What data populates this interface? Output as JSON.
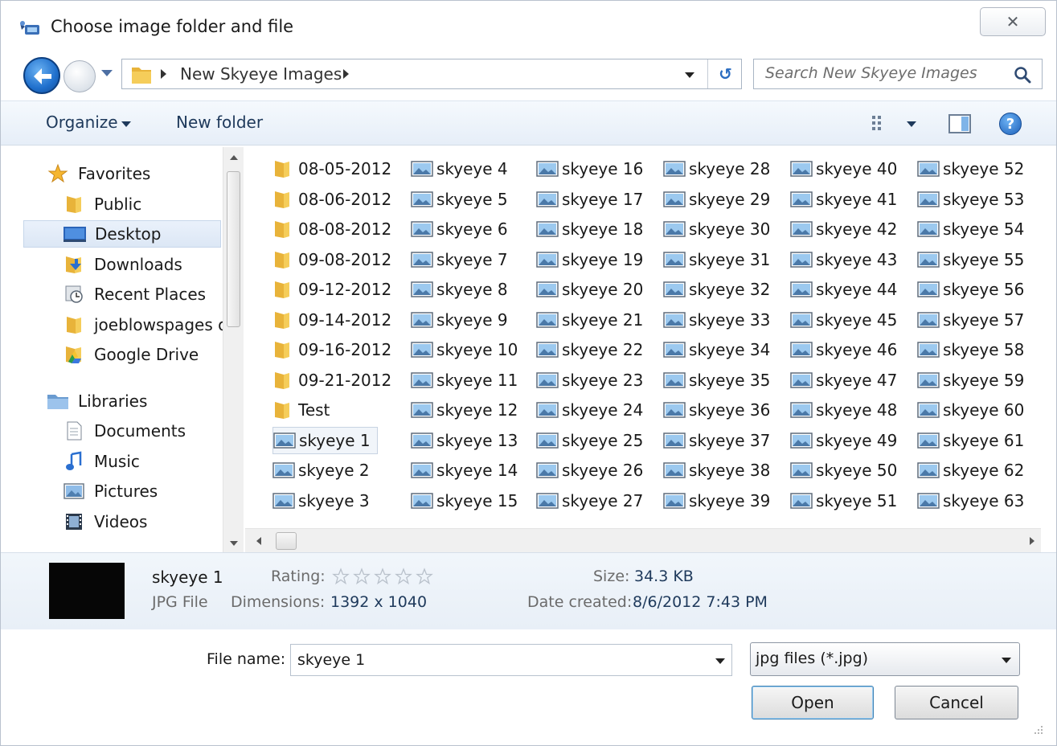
{
  "window": {
    "title": "Choose image folder and file",
    "close_glyph": "✕"
  },
  "address": {
    "path": "New Skyeye Images",
    "search_placeholder": "Search New Skyeye Images"
  },
  "toolbar": {
    "organize": "Organize",
    "new_folder": "New folder",
    "help_glyph": "?"
  },
  "nav": {
    "items": [
      {
        "label": "Favorites",
        "icon": "star-icon",
        "indent": 0
      },
      {
        "label": "Public",
        "icon": "folder-icon",
        "indent": 1
      },
      {
        "label": "Desktop",
        "icon": "desktop-icon",
        "indent": 1,
        "selected": true
      },
      {
        "label": "Downloads",
        "icon": "downloads-icon",
        "indent": 1
      },
      {
        "label": "Recent Places",
        "icon": "recent-places-icon",
        "indent": 1
      },
      {
        "label": "joeblowspages o",
        "icon": "folder-icon",
        "indent": 1
      },
      {
        "label": "Google Drive",
        "icon": "google-drive-icon",
        "indent": 1
      },
      {
        "label": "Libraries",
        "icon": "libraries-icon",
        "indent": 0,
        "gap": true
      },
      {
        "label": "Documents",
        "icon": "document-icon",
        "indent": 1
      },
      {
        "label": "Music",
        "icon": "music-icon",
        "indent": 1
      },
      {
        "label": "Pictures",
        "icon": "pictures-icon",
        "indent": 1
      },
      {
        "label": "Videos",
        "icon": "videos-icon",
        "indent": 1
      }
    ]
  },
  "files": {
    "columns": [
      [
        {
          "name": "08-05-2012",
          "type": "folder"
        },
        {
          "name": "08-06-2012",
          "type": "folder"
        },
        {
          "name": "08-08-2012",
          "type": "folder"
        },
        {
          "name": "09-08-2012",
          "type": "folder"
        },
        {
          "name": "09-12-2012",
          "type": "folder"
        },
        {
          "name": "09-14-2012",
          "type": "folder"
        },
        {
          "name": "09-16-2012",
          "type": "folder"
        },
        {
          "name": "09-21-2012",
          "type": "folder"
        },
        {
          "name": "Test",
          "type": "folder"
        },
        {
          "name": "skyeye 1",
          "type": "image",
          "selected": true
        },
        {
          "name": "skyeye 2",
          "type": "image"
        },
        {
          "name": "skyeye 3",
          "type": "image"
        }
      ],
      [
        {
          "name": "skyeye 4",
          "type": "image"
        },
        {
          "name": "skyeye 5",
          "type": "image"
        },
        {
          "name": "skyeye 6",
          "type": "image"
        },
        {
          "name": "skyeye 7",
          "type": "image"
        },
        {
          "name": "skyeye 8",
          "type": "image"
        },
        {
          "name": "skyeye 9",
          "type": "image"
        },
        {
          "name": "skyeye 10",
          "type": "image"
        },
        {
          "name": "skyeye 11",
          "type": "image"
        },
        {
          "name": "skyeye 12",
          "type": "image"
        },
        {
          "name": "skyeye 13",
          "type": "image"
        },
        {
          "name": "skyeye 14",
          "type": "image"
        },
        {
          "name": "skyeye 15",
          "type": "image"
        }
      ],
      [
        {
          "name": "skyeye 16",
          "type": "image"
        },
        {
          "name": "skyeye 17",
          "type": "image"
        },
        {
          "name": "skyeye 18",
          "type": "image"
        },
        {
          "name": "skyeye 19",
          "type": "image"
        },
        {
          "name": "skyeye 20",
          "type": "image"
        },
        {
          "name": "skyeye 21",
          "type": "image"
        },
        {
          "name": "skyeye 22",
          "type": "image"
        },
        {
          "name": "skyeye 23",
          "type": "image"
        },
        {
          "name": "skyeye 24",
          "type": "image"
        },
        {
          "name": "skyeye 25",
          "type": "image"
        },
        {
          "name": "skyeye 26",
          "type": "image"
        },
        {
          "name": "skyeye 27",
          "type": "image"
        }
      ],
      [
        {
          "name": "skyeye 28",
          "type": "image"
        },
        {
          "name": "skyeye 29",
          "type": "image"
        },
        {
          "name": "skyeye 30",
          "type": "image"
        },
        {
          "name": "skyeye 31",
          "type": "image"
        },
        {
          "name": "skyeye 32",
          "type": "image"
        },
        {
          "name": "skyeye 33",
          "type": "image"
        },
        {
          "name": "skyeye 34",
          "type": "image"
        },
        {
          "name": "skyeye 35",
          "type": "image"
        },
        {
          "name": "skyeye 36",
          "type": "image"
        },
        {
          "name": "skyeye 37",
          "type": "image"
        },
        {
          "name": "skyeye 38",
          "type": "image"
        },
        {
          "name": "skyeye 39",
          "type": "image"
        }
      ],
      [
        {
          "name": "skyeye 40",
          "type": "image"
        },
        {
          "name": "skyeye 41",
          "type": "image"
        },
        {
          "name": "skyeye 42",
          "type": "image"
        },
        {
          "name": "skyeye 43",
          "type": "image"
        },
        {
          "name": "skyeye 44",
          "type": "image"
        },
        {
          "name": "skyeye 45",
          "type": "image"
        },
        {
          "name": "skyeye 46",
          "type": "image"
        },
        {
          "name": "skyeye 47",
          "type": "image"
        },
        {
          "name": "skyeye 48",
          "type": "image"
        },
        {
          "name": "skyeye 49",
          "type": "image"
        },
        {
          "name": "skyeye 50",
          "type": "image"
        },
        {
          "name": "skyeye 51",
          "type": "image"
        }
      ],
      [
        {
          "name": "skyeye 52",
          "type": "image"
        },
        {
          "name": "skyeye 53",
          "type": "image"
        },
        {
          "name": "skyeye 54",
          "type": "image"
        },
        {
          "name": "skyeye 55",
          "type": "image"
        },
        {
          "name": "skyeye 56",
          "type": "image"
        },
        {
          "name": "skyeye 57",
          "type": "image"
        },
        {
          "name": "skyeye 58",
          "type": "image"
        },
        {
          "name": "skyeye 59",
          "type": "image"
        },
        {
          "name": "skyeye 60",
          "type": "image"
        },
        {
          "name": "skyeye 61",
          "type": "image"
        },
        {
          "name": "skyeye 62",
          "type": "image"
        },
        {
          "name": "skyeye 63",
          "type": "image"
        }
      ]
    ]
  },
  "details": {
    "name": "skyeye 1",
    "type": "JPG File",
    "rating_label": "Rating:",
    "rating_value": 0,
    "rating_max": 5,
    "dimensions_label": "Dimensions:",
    "dimensions_value": "1392 x 1040",
    "size_label": "Size:",
    "size_value": "34.3 KB",
    "date_label": "Date created:",
    "date_value": "8/6/2012 7:43 PM"
  },
  "bottom": {
    "file_name_label": "File name:",
    "file_name_value": "skyeye 1",
    "file_type_value": "jpg files (*.jpg)",
    "open_label": "Open",
    "cancel_label": "Cancel"
  },
  "colors": {
    "accent": "#1e395b",
    "folder": "#e8b33a",
    "selection": "#dce7f5"
  }
}
